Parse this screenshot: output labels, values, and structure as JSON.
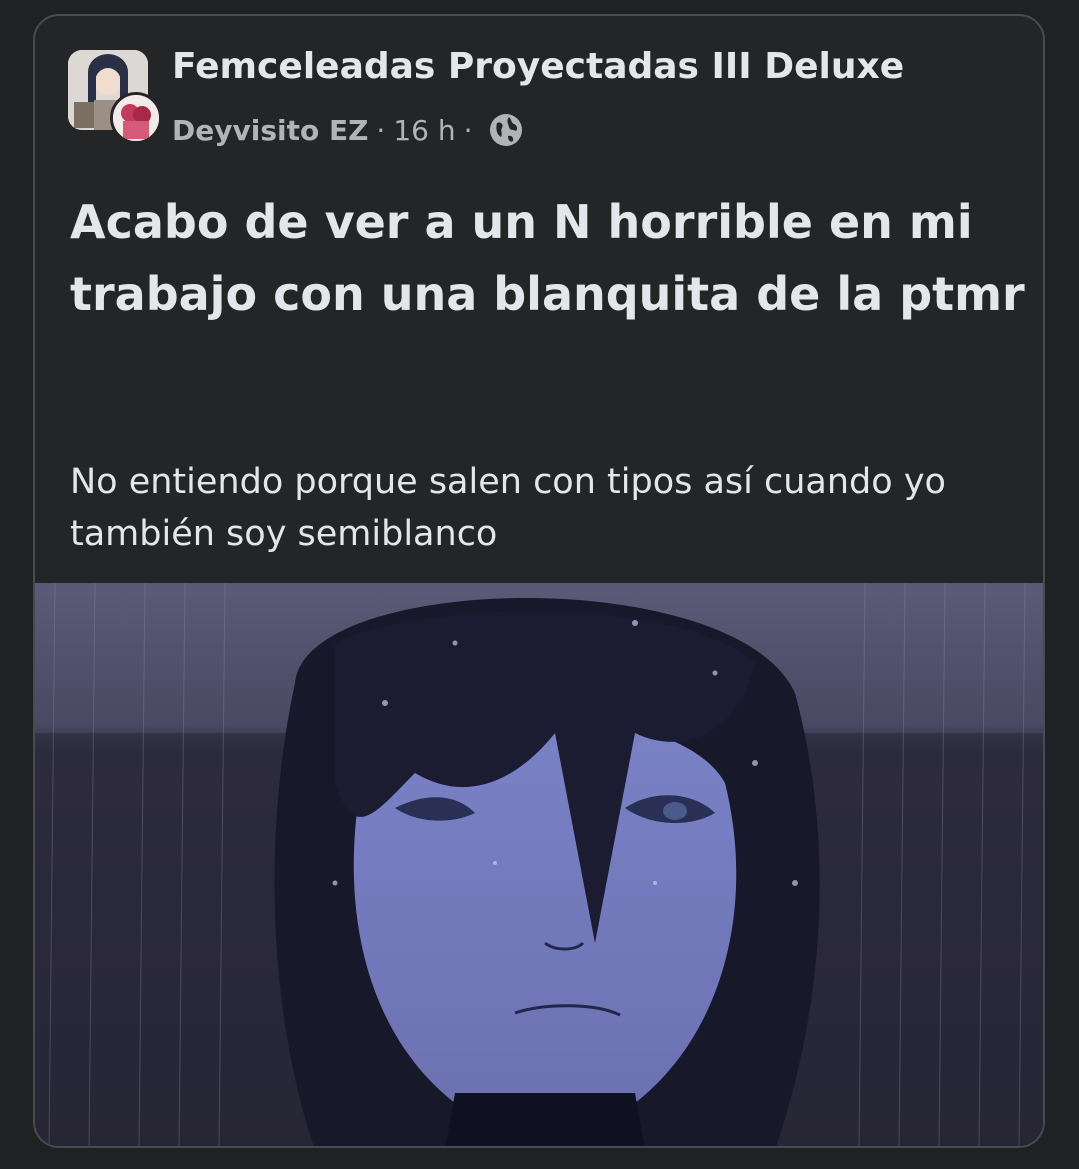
{
  "post": {
    "group_name": "Femceleadas Proyectadas III Deluxe",
    "author": "Deyvisito EZ",
    "separator": "·",
    "time": "16 h",
    "privacy_icon": "globe-icon",
    "title": "Acabo de ver a un N horrible en mi trabajo con una blanquita de la ptmr",
    "body": "No entiendo porque salen con tipos así cuando yo también soy semiblanco",
    "image_icon": "crying-anime-character-rain-image"
  },
  "colors": {
    "background": "#202124",
    "card": "#242526",
    "primary_text": "#e4e6eb",
    "secondary_text": "#b0b3b8"
  }
}
